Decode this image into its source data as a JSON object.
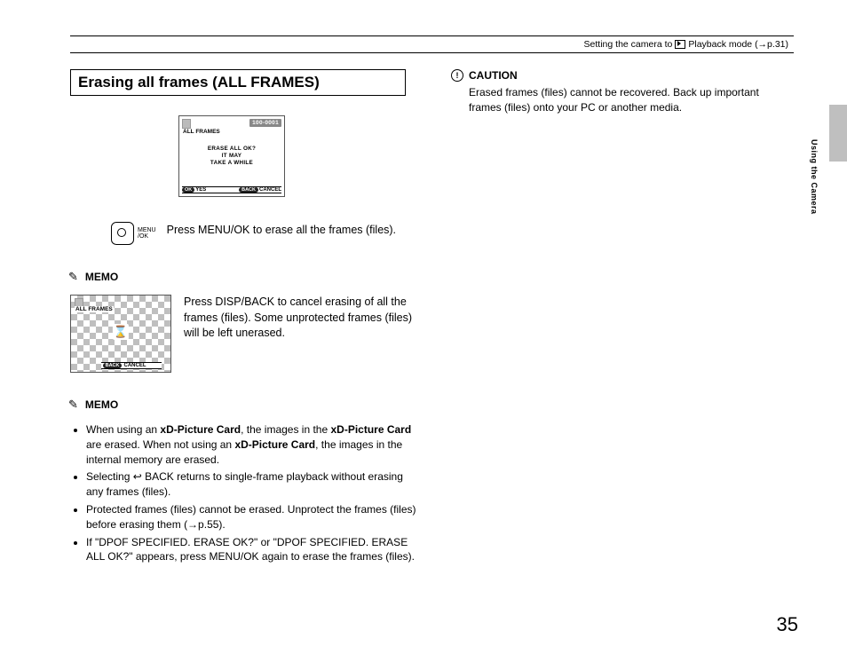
{
  "header": {
    "breadcrumb_prefix": "Setting the camera to ",
    "breadcrumb_suffix": " Playback mode (→p.31)"
  },
  "section": {
    "title": "Erasing all frames (ALL FRAMES)"
  },
  "lcd1": {
    "file_no": "100-0001",
    "mode": "ALL FRAMES",
    "line1": "ERASE ALL OK?",
    "line2": "IT  MAY",
    "line3": "TAKE  A  WHILE",
    "ok_pill": "OK",
    "yes": "YES",
    "back_pill": "BACK",
    "cancel": "CANCEL"
  },
  "instruction": {
    "menu_label_1": "MENU",
    "menu_label_2": "/OK",
    "text": "Press MENU/OK to erase all the frames (files)."
  },
  "memo_label": "MEMO",
  "lcd2": {
    "mode": "ALL FRAMES",
    "back_pill": "BACK",
    "cancel": "CANCEL"
  },
  "memo1_text": "Press DISP/BACK to cancel erasing of all the frames (files). Some unprotected frames (files) will be left unerased.",
  "memo2": {
    "b1_a": "When using an ",
    "b1_xd": "xD-Picture Card",
    "b1_b": ", the images in the ",
    "b1_xd2": "xD-Picture Card",
    "b1_c": " are erased. When not using an ",
    "b1_xd3": "xD-Picture Card",
    "b1_d": ", the images in the internal memory are erased.",
    "b2": "Selecting ↩ BACK returns to single-frame playback without erasing any frames (files).",
    "b3": "Protected frames (files) cannot be erased. Unprotect the frames (files) before erasing them (→p.55).",
    "b4": "If \"DPOF SPECIFIED. ERASE OK?\" or \"DPOF SPECIFIED. ERASE ALL OK?\" appears, press MENU/OK again to erase the frames (files)."
  },
  "caution": {
    "label": "CAUTION",
    "text": "Erased frames (files) cannot be recovered. Back up important frames (files) onto your PC or another media."
  },
  "side_label": "Using the Camera",
  "page_number": "35"
}
